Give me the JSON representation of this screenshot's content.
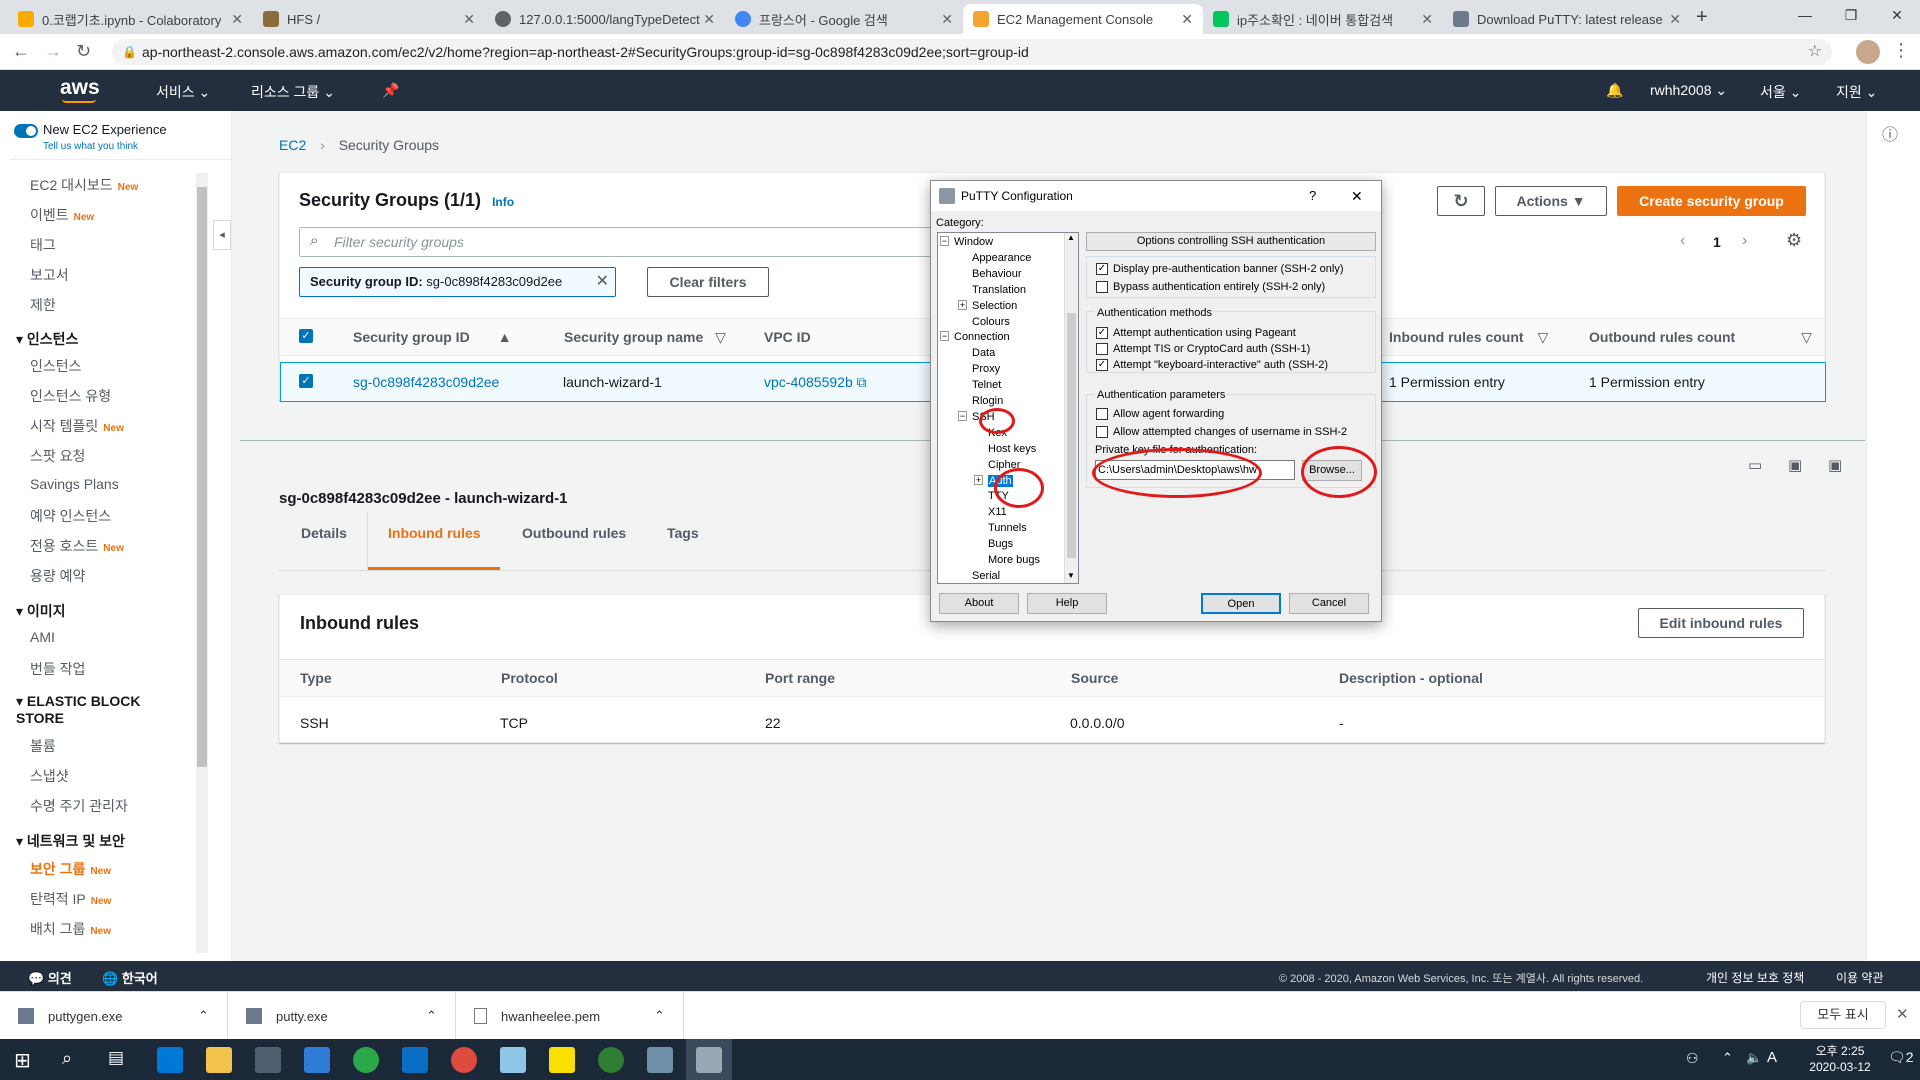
{
  "browser": {
    "tabs": [
      {
        "label": "0.코랩기초.ipynb - Colaboratory",
        "color": "#f9ab00"
      },
      {
        "label": "HFS /",
        "color": "#8a6d3b"
      },
      {
        "label": "127.0.0.1:5000/langTypeDetect",
        "color": "#5f6368"
      },
      {
        "label": "프랑스어 - Google 검색",
        "color": "#4285f4"
      },
      {
        "label": "EC2 Management Console",
        "color": "#f2a533"
      },
      {
        "label": "ip주소확인 : 네이버 통합검색",
        "color": "#03c75a"
      },
      {
        "label": "Download PuTTY: latest release",
        "color": "#6b7a8f"
      }
    ],
    "new_tab": "+",
    "url": "ap-northeast-2.console.aws.amazon.com/ec2/v2/home?region=ap-northeast-2#SecurityGroups:group-id=sg-0c898f4283c09d2ee;sort=group-id"
  },
  "aws_header": {
    "logo": "aws",
    "services": "서비스",
    "resource_groups": "리소스 그룹",
    "user": "rwhh2008",
    "region": "서울",
    "support": "지원"
  },
  "sidebar": {
    "new_exp": "New EC2 Experience",
    "tell_us": "Tell us what you think",
    "new_badge": "New",
    "items": [
      {
        "label": "EC2 대시보드",
        "new": true
      },
      {
        "label": "이벤트",
        "new": true
      },
      {
        "label": "태그"
      },
      {
        "label": "보고서"
      },
      {
        "label": "제한"
      }
    ],
    "section_instances": "인스턴스",
    "instances": [
      {
        "label": "인스턴스"
      },
      {
        "label": "인스턴스 유형"
      },
      {
        "label": "시작 템플릿",
        "new": true
      },
      {
        "label": "스팟 요청"
      },
      {
        "label": "Savings Plans"
      },
      {
        "label": "예약 인스턴스"
      },
      {
        "label": "전용 호스트",
        "new": true
      },
      {
        "label": "용량 예약"
      }
    ],
    "section_images": "이미지",
    "images": [
      {
        "label": "AMI"
      },
      {
        "label": "번들 작업"
      }
    ],
    "section_ebs": "ELASTIC BLOCK STORE",
    "ebs": [
      {
        "label": "볼륨"
      },
      {
        "label": "스냅샷"
      },
      {
        "label": "수명 주기 관리자"
      }
    ],
    "section_network": "네트워크 및 보안",
    "network": [
      {
        "label": "보안 그룹",
        "new": true,
        "active": true
      },
      {
        "label": "탄력적 IP",
        "new": true
      },
      {
        "label": "배치 그룹",
        "new": true
      }
    ]
  },
  "breadcrumb": {
    "root": "EC2",
    "current": "Security Groups"
  },
  "sg_panel": {
    "title": "Security Groups (1/1)",
    "info": "Info",
    "filter_placeholder": "Filter security groups",
    "filter_token": "Security group ID: sg-0c898f4283c09d2ee",
    "filter_token_key": "Security group ID:",
    "filter_token_value": " sg-0c898f4283c09d2ee",
    "clear_filters": "Clear filters",
    "actions": "Actions",
    "create": "Create security group",
    "page": "1",
    "columns": [
      "Security group ID",
      "Security group name",
      "VPC ID",
      "Inbound rules count",
      "Outbound rules count"
    ],
    "row": {
      "id": "sg-0c898f4283c09d2ee",
      "name": "launch-wizard-1",
      "vpc": "vpc-4085592b",
      "inbound": "1 Permission entry",
      "outbound": "1 Permission entry"
    }
  },
  "detail": {
    "title": "sg-0c898f4283c09d2ee - launch-wizard-1",
    "tabs": [
      "Details",
      "Inbound rules",
      "Outbound rules",
      "Tags"
    ],
    "active_tab": "Inbound rules",
    "inbound_title": "Inbound rules",
    "edit": "Edit inbound rules",
    "columns": [
      "Type",
      "Protocol",
      "Port range",
      "Source",
      "Description - optional"
    ],
    "rows": [
      {
        "type": "SSH",
        "protocol": "TCP",
        "port": "22",
        "source": "0.0.0.0/0",
        "desc": "-"
      }
    ]
  },
  "footer": {
    "feedback": "의견",
    "language": "한국어",
    "copyright": "© 2008 - 2020, Amazon Web Services, Inc. 또는 계열사. All rights reserved.",
    "privacy": "개인 정보 보호 정책",
    "terms": "이용 약관"
  },
  "downloads": {
    "items": [
      "puttygen.exe",
      "putty.exe",
      "hwanheelee.pem"
    ],
    "show_all": "모두 표시"
  },
  "taskbar": {
    "time": "오후 2:25",
    "date": "2020-03-12",
    "lang": "A",
    "notif": "2"
  },
  "putty": {
    "title": "PuTTY Configuration",
    "help_q": "?",
    "category": "Category:",
    "tree": [
      {
        "label": "Window",
        "level": 0,
        "toggle": "−"
      },
      {
        "label": "Appearance",
        "level": 1
      },
      {
        "label": "Behaviour",
        "level": 1
      },
      {
        "label": "Translation",
        "level": 1
      },
      {
        "label": "Selection",
        "level": 1,
        "toggle": "+"
      },
      {
        "label": "Colours",
        "level": 1
      },
      {
        "label": "Connection",
        "level": 0,
        "toggle": "−"
      },
      {
        "label": "Data",
        "level": 1
      },
      {
        "label": "Proxy",
        "level": 1
      },
      {
        "label": "Telnet",
        "level": 1
      },
      {
        "label": "Rlogin",
        "level": 1
      },
      {
        "label": "SSH",
        "level": 1,
        "toggle": "−"
      },
      {
        "label": "Kex",
        "level": 2
      },
      {
        "label": "Host keys",
        "level": 2
      },
      {
        "label": "Cipher",
        "level": 2
      },
      {
        "label": "Auth",
        "level": 2,
        "toggle": "+",
        "selected": true
      },
      {
        "label": "TTY",
        "level": 2
      },
      {
        "label": "X11",
        "level": 2
      },
      {
        "label": "Tunnels",
        "level": 2
      },
      {
        "label": "Bugs",
        "level": 2
      },
      {
        "label": "More bugs",
        "level": 2
      },
      {
        "label": "Serial",
        "level": 1
      }
    ],
    "header": "Options controlling SSH authentication",
    "checks_top": [
      {
        "label": "Display pre-authentication banner (SSH-2 only)",
        "checked": true
      },
      {
        "label": "Bypass authentication entirely (SSH-2 only)",
        "checked": false
      }
    ],
    "methods_title": "Authentication methods",
    "methods": [
      {
        "label": "Attempt authentication using Pageant",
        "checked": true
      },
      {
        "label": "Attempt TIS or CryptoCard auth (SSH-1)",
        "checked": false
      },
      {
        "label": "Attempt \"keyboard-interactive\" auth (SSH-2)",
        "checked": true
      }
    ],
    "params_title": "Authentication parameters",
    "params": [
      {
        "label": "Allow agent forwarding",
        "checked": false
      },
      {
        "label": "Allow attempted changes of username in SSH-2",
        "checked": false
      }
    ],
    "key_label": "Private key file for authentication:",
    "key_value": "C:\\Users\\admin\\Desktop\\aws\\hw",
    "browse": "Browse...",
    "about": "About",
    "help": "Help",
    "open": "Open",
    "cancel": "Cancel"
  },
  "colors": {
    "aws_orange": "#ec7211",
    "aws_dark": "#232f3e",
    "link": "#0073bb",
    "annotation_red": "#e01a1a"
  }
}
